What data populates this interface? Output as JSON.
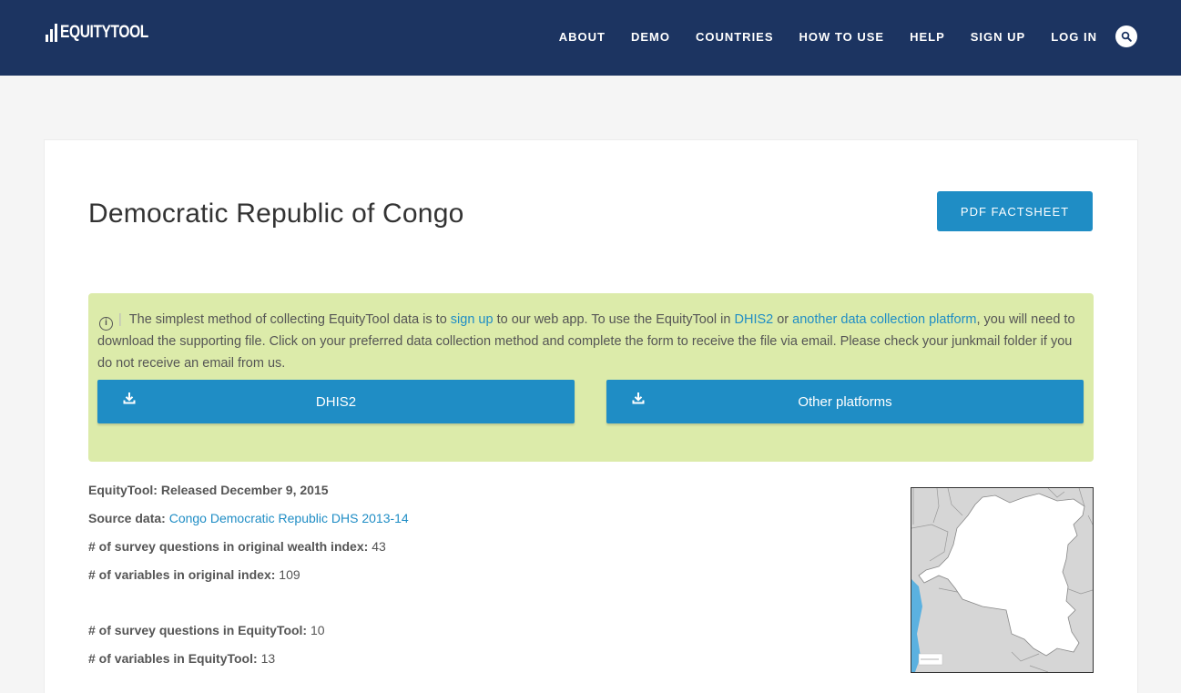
{
  "header": {
    "logo_text": "EQUITYTOOL",
    "nav": [
      "ABOUT",
      "DEMO",
      "COUNTRIES",
      "HOW TO USE",
      "HELP",
      "SIGN UP",
      "LOG IN"
    ]
  },
  "page": {
    "title": "Democratic Republic of Congo",
    "pdf_button": "PDF FACTSHEET"
  },
  "notice": {
    "text_1": "The simplest method of collecting EquityTool data is to ",
    "link_signup": "sign up",
    "text_2": " to our web app. To use the EquityTool in ",
    "link_dhis2": "DHIS2",
    "text_3": " or ",
    "link_other": "another data collection platform",
    "text_4": ", you will need to download the supporting file. Click on your preferred data collection method and complete the form to receive the file via email. Please check your junkmail folder if you do not receive an email from us.",
    "button_dhis2": "DHIS2",
    "button_other": "Other platforms"
  },
  "facts": {
    "released": "EquityTool: Released December 9, 2015",
    "source_label": "Source data:",
    "source_value": "Congo Democratic Republic DHS 2013-14",
    "wealth_q_label": "# of survey questions in original wealth index:",
    "wealth_q_value": "43",
    "orig_vars_label": "# of variables in original index:",
    "orig_vars_value": "109",
    "et_q_label": "# of survey questions in EquityTool:",
    "et_q_value": "10",
    "et_vars_label": "# of variables in EquityTool:",
    "et_vars_value": "13"
  },
  "colors": {
    "header_bg": "#1c3461",
    "accent": "#1f8dc5",
    "notice_bg": "#dcebaa"
  }
}
